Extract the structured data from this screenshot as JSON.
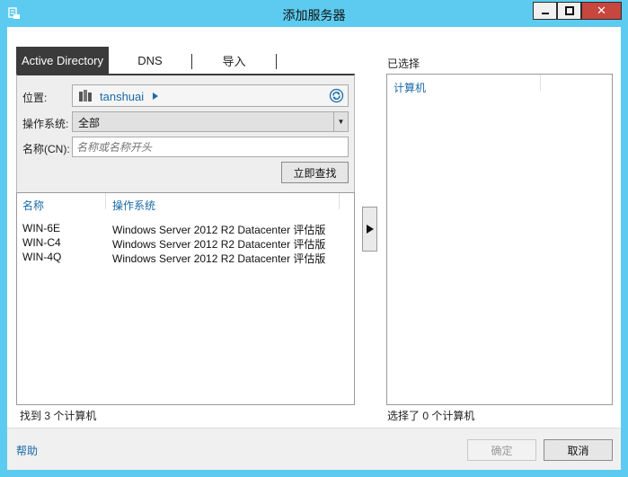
{
  "window": {
    "title": "添加服务器",
    "close_label": "✕",
    "colors": {
      "titlebar": "#5ccbef",
      "close": "#c7463d",
      "link": "#1a6aa8"
    }
  },
  "tabs": [
    {
      "label": "Active Directory",
      "selected": true
    },
    {
      "label": "DNS",
      "selected": false
    },
    {
      "label": "导入",
      "selected": false
    }
  ],
  "search": {
    "location_label": "位置:",
    "location_value": "tanshuai",
    "os_label": "操作系统:",
    "os_value": "全部",
    "name_label": "名称(CN):",
    "name_placeholder": "名称或名称开头",
    "find_button": "立即查找"
  },
  "results": {
    "columns": [
      "名称",
      "操作系统"
    ],
    "rows": [
      {
        "name": "WIN-6E",
        "os": "Windows Server 2012 R2 Datacenter 评估版"
      },
      {
        "name": "WIN-C4",
        "os": "Windows Server 2012 R2 Datacenter 评估版"
      },
      {
        "name": "WIN-4Q",
        "os": "Windows Server 2012 R2 Datacenter 评估版"
      }
    ],
    "status": "找到 3 个计算机"
  },
  "selected": {
    "label": "已选择",
    "column": "计算机",
    "status": "选择了 0 个计算机"
  },
  "footer": {
    "help": "帮助",
    "ok": "确定",
    "cancel": "取消"
  }
}
